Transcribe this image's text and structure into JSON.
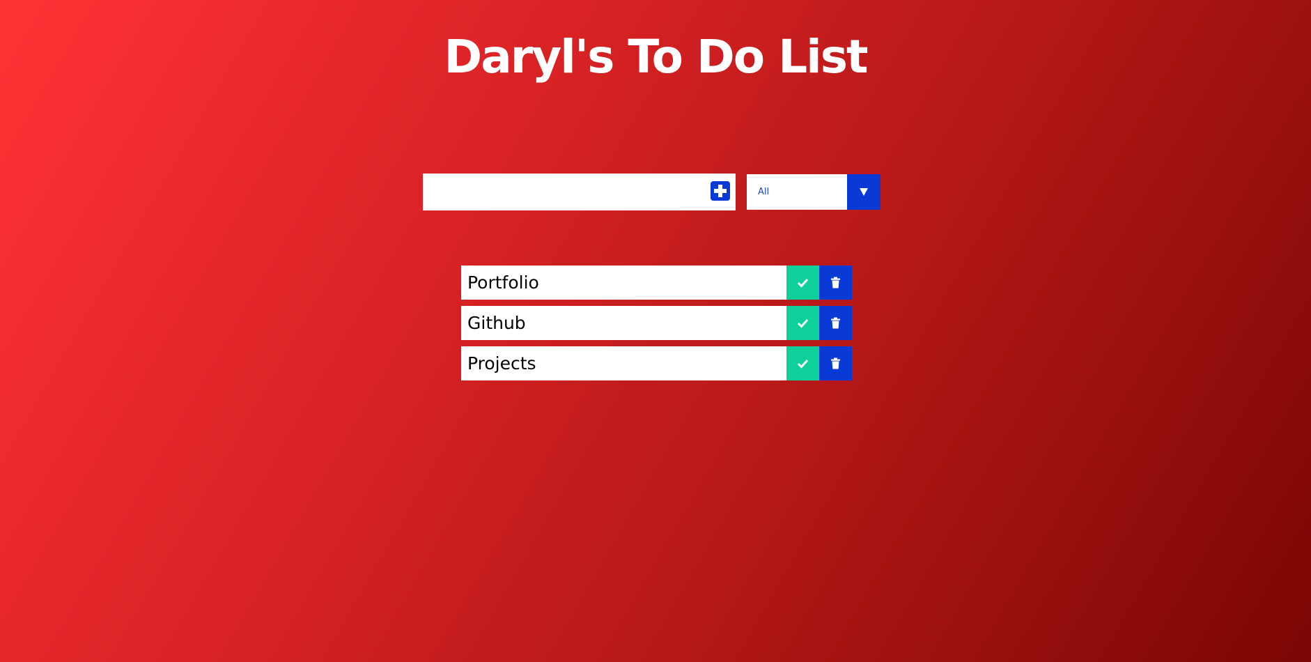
{
  "header": {
    "title": "Daryl's To Do List"
  },
  "form": {
    "input_value": "",
    "input_placeholder": "",
    "add_icon": "plus-square-icon",
    "filter_selected": "All",
    "dropdown_icon": "caret-down-icon"
  },
  "todos": [
    {
      "text": "Portfolio",
      "complete_icon": "check-icon",
      "delete_icon": "trash-icon"
    },
    {
      "text": "Github",
      "complete_icon": "check-icon",
      "delete_icon": "trash-icon"
    },
    {
      "text": "Projects",
      "complete_icon": "check-icon",
      "delete_icon": "trash-icon"
    }
  ],
  "colors": {
    "background_start": "#ff3235",
    "background_end": "#7a0603",
    "primary_blue": "#0a3ad6",
    "complete_green": "#0fcf9b",
    "text_white": "#ffffff"
  }
}
